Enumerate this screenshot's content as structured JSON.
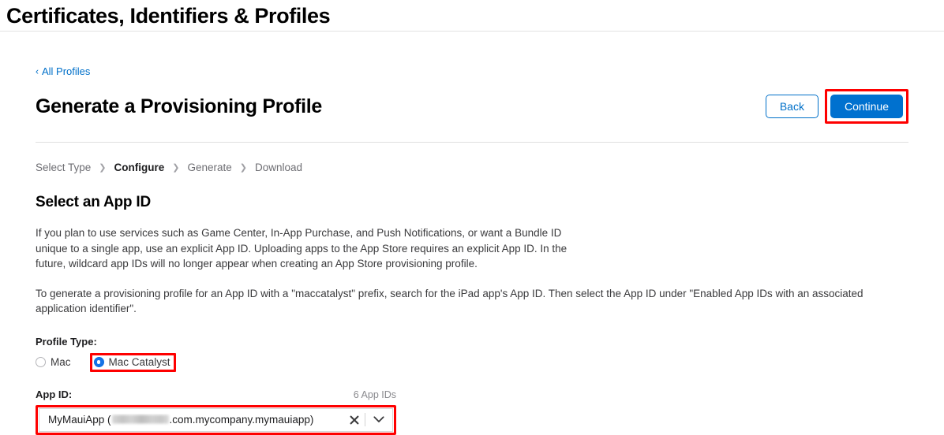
{
  "header": {
    "title": "Certificates, Identifiers & Profiles"
  },
  "back_link": {
    "chevron": "‹",
    "label": "All Profiles"
  },
  "page": {
    "title": "Generate a Provisioning Profile"
  },
  "actions": {
    "back_label": "Back",
    "continue_label": "Continue"
  },
  "steps": {
    "separator": "❯",
    "items": [
      {
        "label": "Select Type",
        "active": false
      },
      {
        "label": "Configure",
        "active": true
      },
      {
        "label": "Generate",
        "active": false
      },
      {
        "label": "Download",
        "active": false
      }
    ]
  },
  "section": {
    "title": "Select an App ID",
    "paragraph1": "If you plan to use services such as Game Center, In-App Purchase, and Push Notifications, or want a Bundle ID unique to a single app, use an explicit App ID. Uploading apps to the App Store requires an explicit App ID. In the future, wildcard app IDs will no longer appear when creating an App Store provisioning profile.",
    "paragraph2": "To generate a provisioning profile for an App ID with a \"maccatalyst\" prefix, search for the iPad app's App ID. Then select the App ID under \"Enabled App IDs with an associated application identifier\"."
  },
  "profile_type": {
    "label": "Profile Type:",
    "options": [
      {
        "label": "Mac",
        "selected": false
      },
      {
        "label": "Mac Catalyst",
        "selected": true
      }
    ]
  },
  "app_id": {
    "label": "App ID:",
    "count_label": "6 App IDs",
    "value_prefix": "MyMauiApp (",
    "value_redacted": "",
    "value_suffix": ".com.mycompany.mymauiapp)",
    "clear_icon": "✕",
    "chevron_icon": "⌄"
  },
  "colors": {
    "accent_blue": "#0071cf",
    "link_blue": "#0070c9",
    "highlight_red": "#fe0000",
    "radio_blue": "#1673e6"
  }
}
